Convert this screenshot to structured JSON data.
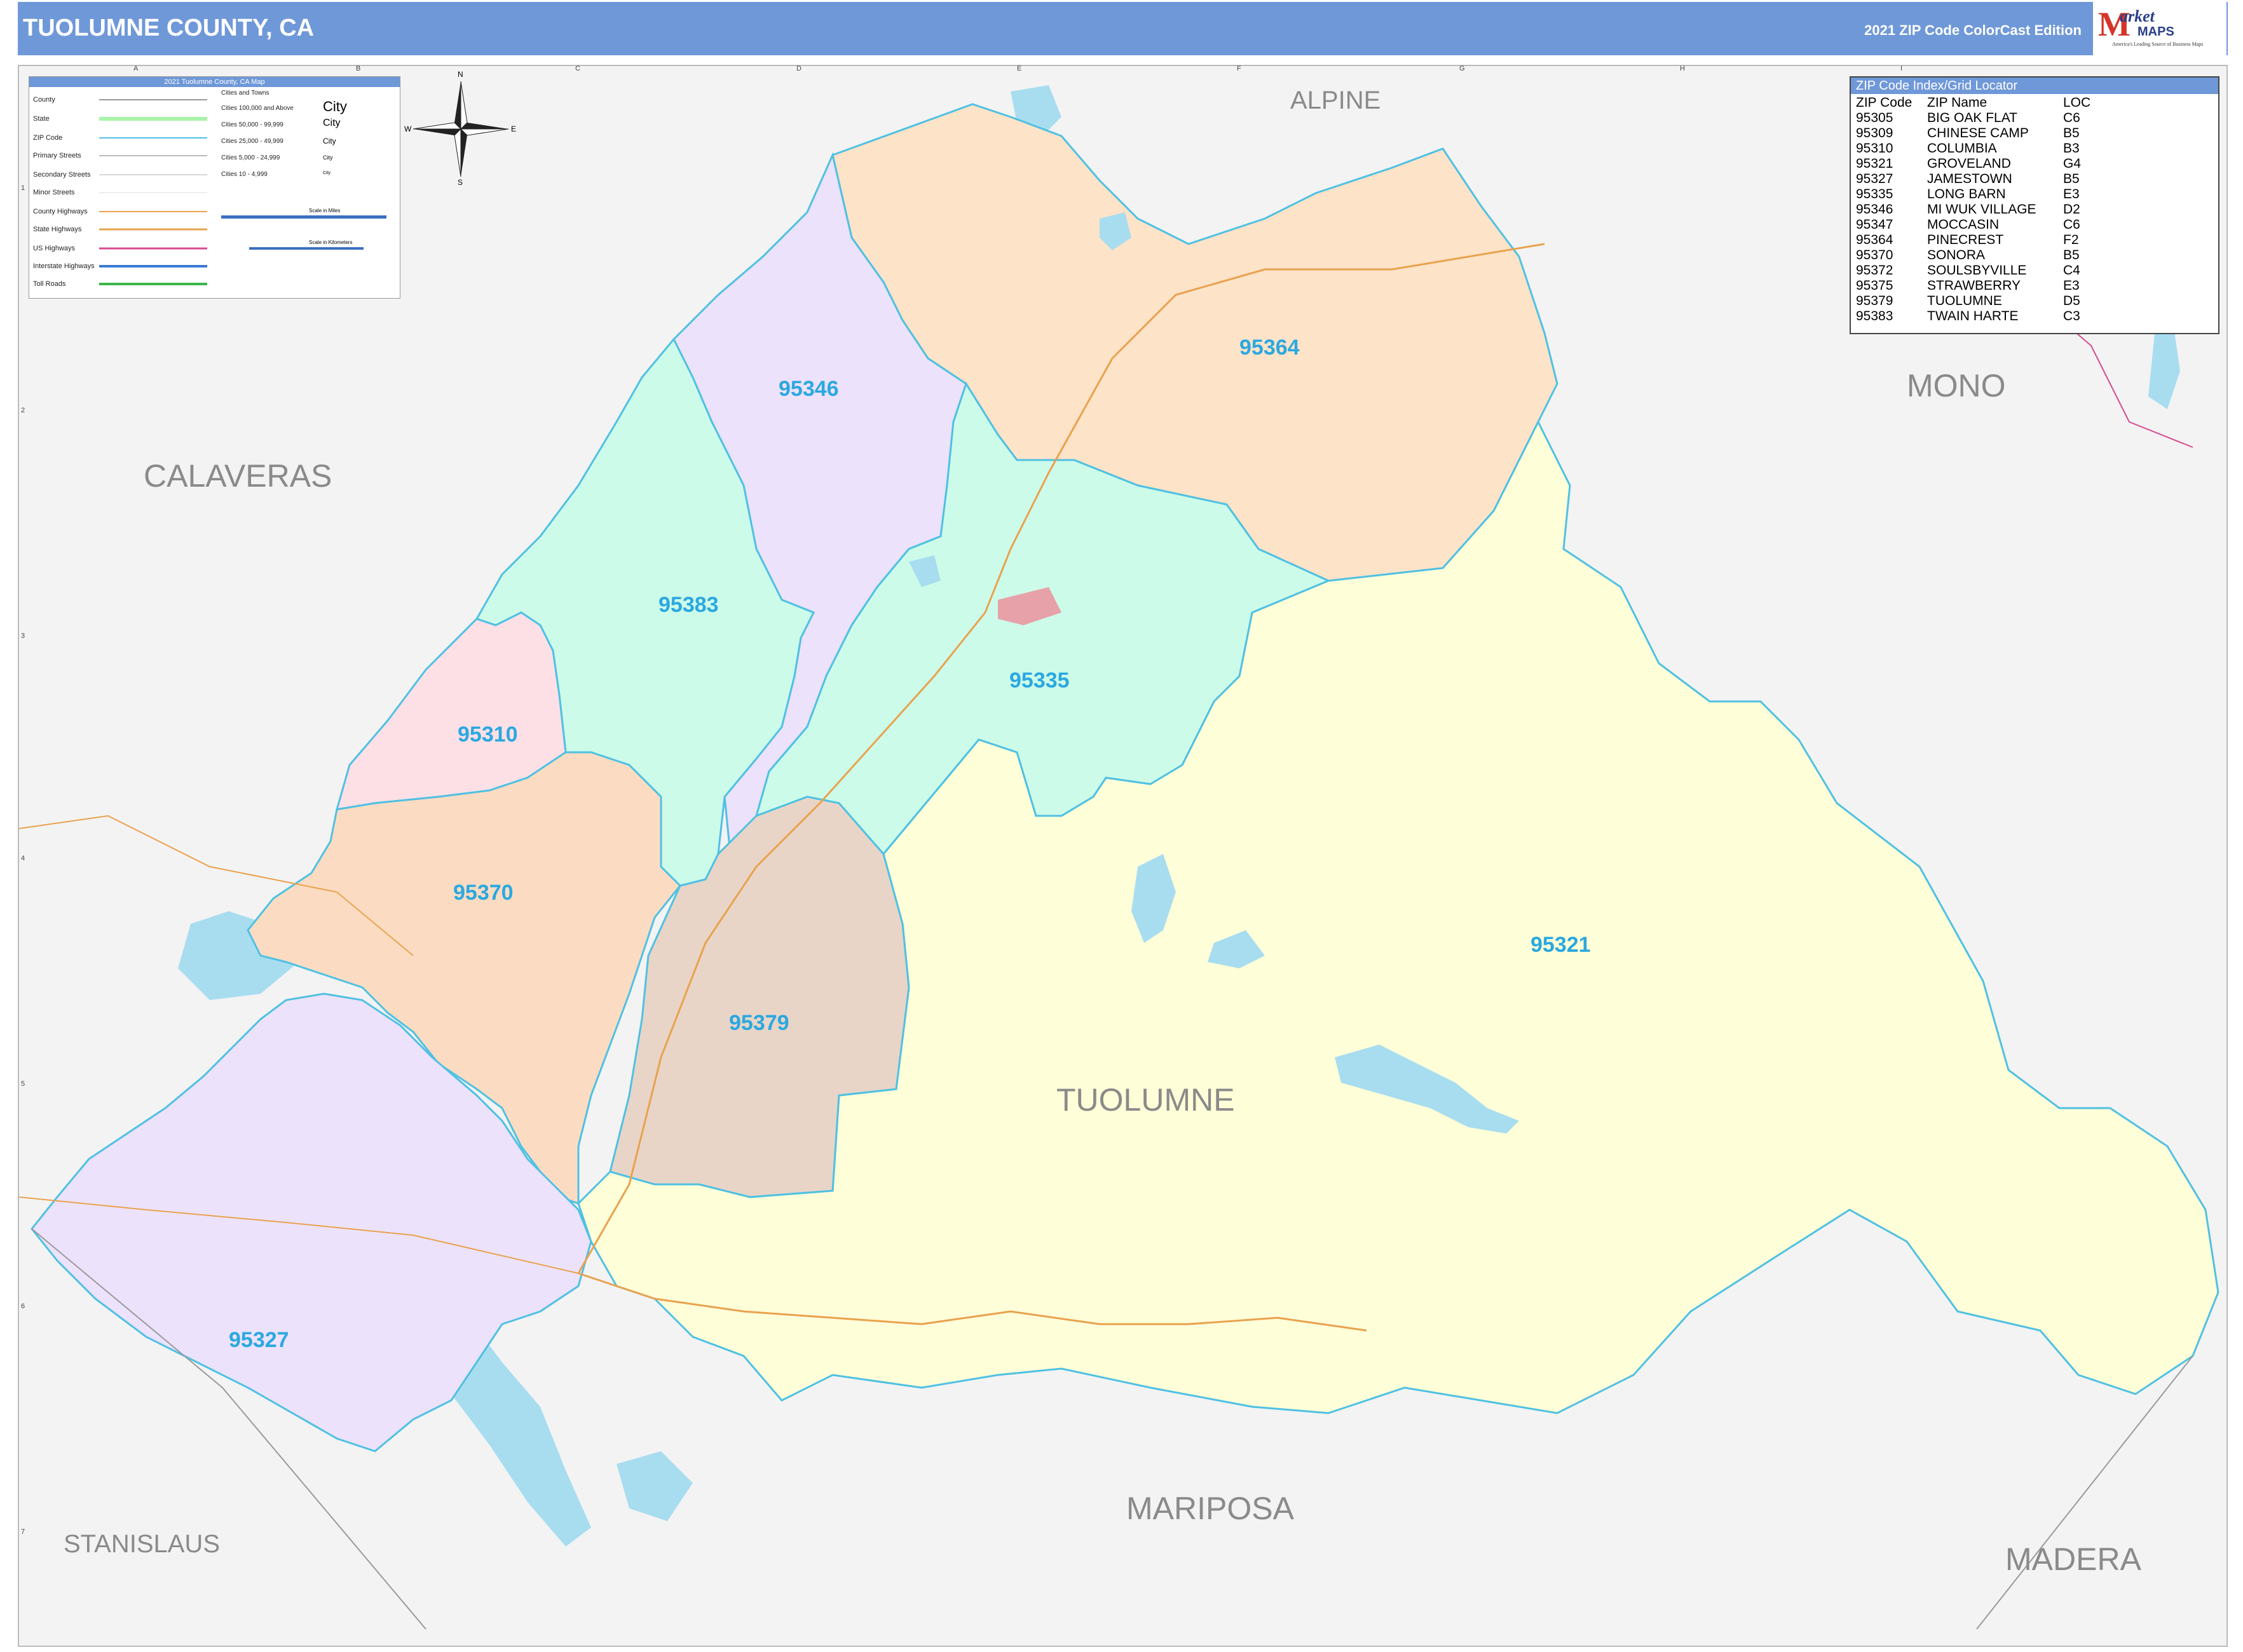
{
  "header": {
    "title": "TUOLUMNE COUNTY, CA",
    "edition": "2021 ZIP Code ColorCast Edition",
    "logo_m": "M",
    "logo_brand": "arket",
    "logo_brand2": "MAPS",
    "logo_tagline": "America's Leading Source of Business Maps"
  },
  "legend": {
    "title": "2021 Tuolumne County, CA Map",
    "items": [
      "County",
      "State",
      "ZIP Code",
      "Primary Streets",
      "Secondary Streets",
      "Minor Streets",
      "County Highways",
      "State Highways",
      "US Highways",
      "Interstate Highways",
      "Toll Roads"
    ],
    "cities_header": "Cities and Towns",
    "city_classes": [
      "Cities 100,000 and Above",
      "Cities 50,000 - 99,999",
      "Cities 25,000 - 49,999",
      "Cities 5,000 - 24,999",
      "Cities 10 - 4,999"
    ],
    "city_samples": [
      "City",
      "City",
      "City",
      "City",
      "City"
    ],
    "scale_miles": "Scale in Miles",
    "scale_km": "Scale in Kilometers"
  },
  "compass": {
    "n": "N",
    "s": "S",
    "e": "E",
    "w": "W"
  },
  "zip_index": {
    "title": "ZIP Code Index/Grid Locator",
    "headers": [
      "ZIP Code",
      "ZIP Name",
      "LOC"
    ],
    "rows": [
      [
        "95305",
        "BIG OAK FLAT",
        "C6"
      ],
      [
        "95309",
        "CHINESE CAMP",
        "B5"
      ],
      [
        "95310",
        "COLUMBIA",
        "B3"
      ],
      [
        "95321",
        "GROVELAND",
        "G4"
      ],
      [
        "95327",
        "JAMESTOWN",
        "B5"
      ],
      [
        "95335",
        "LONG BARN",
        "E3"
      ],
      [
        "95346",
        "MI WUK VILLAGE",
        "D2"
      ],
      [
        "95347",
        "MOCCASIN",
        "C6"
      ],
      [
        "95364",
        "PINECREST",
        "F2"
      ],
      [
        "95370",
        "SONORA",
        "B5"
      ],
      [
        "95372",
        "SOULSBYVILLE",
        "C4"
      ],
      [
        "95375",
        "STRAWBERRY",
        "E3"
      ],
      [
        "95379",
        "TUOLUMNE",
        "D5"
      ],
      [
        "95383",
        "TWAIN HARTE",
        "C3"
      ]
    ]
  },
  "counties": {
    "alpine": "ALPINE",
    "mono": "MONO",
    "calaveras": "CALAVERAS",
    "tuolumne": "TUOLUMNE",
    "mariposa": "MARIPOSA",
    "stanislaus": "STANISLAUS",
    "madera": "MADERA"
  },
  "zips": {
    "z95364": "95364",
    "z95346": "95346",
    "z95383": "95383",
    "z95335": "95335",
    "z95310": "95310",
    "z95370": "95370",
    "z95379": "95379",
    "z95321": "95321",
    "z95327": "95327"
  },
  "grid": {
    "columns": [
      "A",
      "B",
      "C",
      "D",
      "E",
      "F",
      "G",
      "H",
      "I"
    ],
    "rows": [
      "1",
      "2",
      "3",
      "4",
      "5",
      "6",
      "7"
    ]
  },
  "colors": {
    "header": "#6f98d8",
    "zip_label": "#2ba8e0",
    "z95364": "#fde3c8",
    "z95346": "#ece2fb",
    "z95383": "#cdfbe9",
    "z95335": "#cdfbe9",
    "z95310": "#fde0e6",
    "z95370": "#fbdcc2",
    "z95379": "#e8d5c7",
    "z95321": "#fefed8",
    "z95327": "#ece2fb",
    "water": "#a8ddf0"
  }
}
